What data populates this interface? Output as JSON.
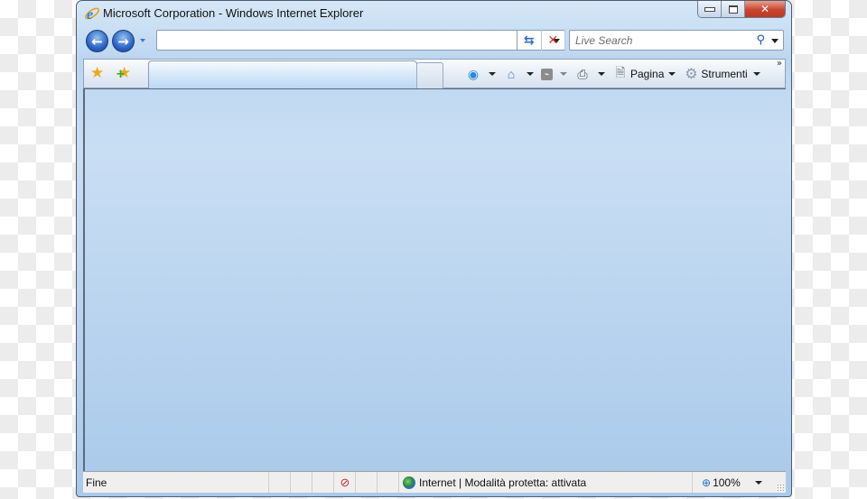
{
  "window": {
    "title": "Microsoft Corporation - Windows Internet Explorer",
    "caption_buttons": [
      "minimize",
      "restore",
      "close"
    ]
  },
  "navbar": {
    "back_icon": "back-arrow-icon",
    "forward_icon": "forward-arrow-icon",
    "address_value": "",
    "refresh_icon": "refresh-icon",
    "stop_icon": "stop-x-icon",
    "search_placeholder": "Live Search",
    "search_icon": "magnifier-icon"
  },
  "command_bar": {
    "favorites_icon": "star-icon",
    "add_favorites_icon": "add-star-icon",
    "tab_label": "",
    "tools": [
      {
        "name": "feeds-share",
        "icon": "messenger-icon",
        "label": ""
      },
      {
        "name": "home",
        "icon": "home-icon",
        "label": ""
      },
      {
        "name": "feeds",
        "icon": "rss-icon",
        "label": ""
      },
      {
        "name": "print",
        "icon": "printer-icon",
        "label": ""
      },
      {
        "name": "page",
        "icon": "page-icon",
        "label": "Pagina"
      },
      {
        "name": "tools",
        "icon": "gear-icon",
        "label": "Strumenti"
      }
    ],
    "overflow": "»"
  },
  "status_bar": {
    "status_text": "Fine",
    "privacy_icon": "privacy-eye-icon",
    "zone_icon": "globe-icon",
    "zone_text": "Internet | Modalità protetta: attivata",
    "zoom_icon": "zoom-magnifier-icon",
    "zoom_level": "100%"
  }
}
